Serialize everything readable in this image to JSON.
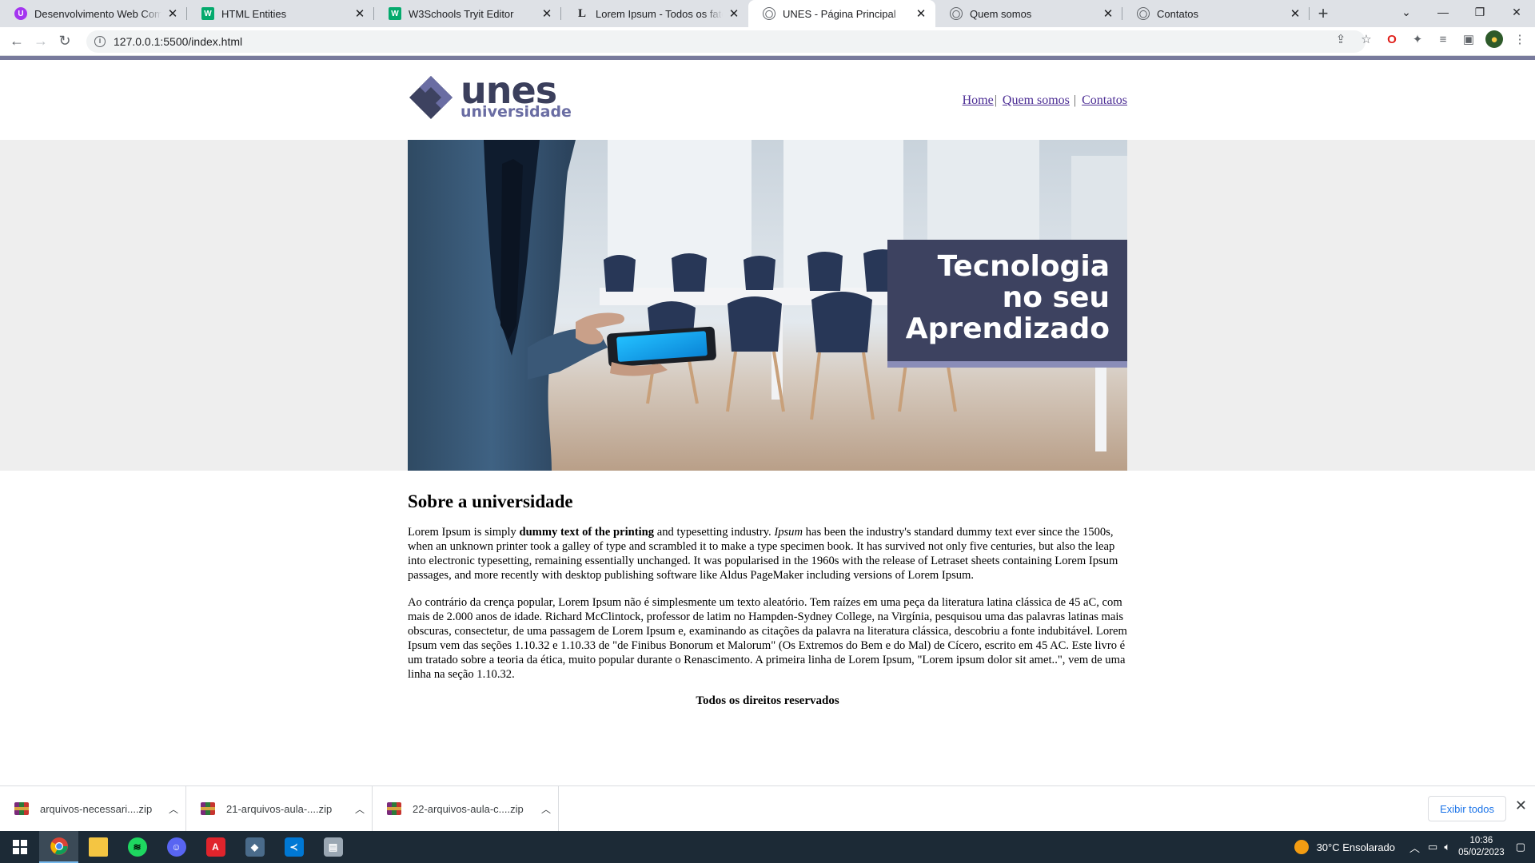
{
  "browser": {
    "tabs": [
      {
        "title": "Desenvolvimento Web Completo",
        "favicon_color": "#a435f0",
        "favicon_glyph": "U"
      },
      {
        "title": "HTML Entities",
        "favicon_color": "#04aa6d",
        "favicon_glyph": "W"
      },
      {
        "title": "W3Schools Tryit Editor",
        "favicon_color": "#04aa6d",
        "favicon_glyph": "W"
      },
      {
        "title": "Lorem Ipsum - Todos os fatos - Lipsum",
        "favicon_color": "#ffffff",
        "favicon_glyph": "L"
      },
      {
        "title": "UNES - Página Principal",
        "favicon_color": "#5f6368",
        "favicon_glyph": "globe"
      },
      {
        "title": "Quem somos",
        "favicon_color": "#5f6368",
        "favicon_glyph": "globe"
      },
      {
        "title": "Contatos",
        "favicon_color": "#5f6368",
        "favicon_glyph": "globe"
      }
    ],
    "active_tab_index": 4,
    "url": "127.0.0.1:5500/index.html"
  },
  "site": {
    "logo_main": "unes",
    "logo_sub": "universidade",
    "menu": {
      "home": "Home",
      "about": "Quem somos",
      "contact": "Contatos",
      "separator": "|"
    },
    "banner_lines": [
      "Tecnologia",
      "no seu",
      "Aprendizado"
    ],
    "section_title": "Sobre a universidade",
    "p1": {
      "a": "Lorem Ipsum is simply ",
      "bold": "dummy text of the printing",
      "b": " and typesetting industry. ",
      "italic": "Ipsum",
      "c": " has been the industry's standard dummy text ever since the 1500s, when an unknown printer took a galley of type and scrambled it to make a type specimen book. It has survived not only five centuries, but also the leap into electronic typesetting, remaining essentially unchanged. It was popularised in the 1960s with the release of Letraset sheets containing Lorem Ipsum passages, and more recently with desktop publishing software like Aldus PageMaker including versions of Lorem Ipsum."
    },
    "p2": "Ao contrário da crença popular, Lorem Ipsum não é simplesmente um texto aleatório. Tem raízes em uma peça da literatura latina clássica de 45 aC, com mais de 2.000 anos de idade. Richard McClintock, professor de latim no Hampden-Sydney College, na Virgínia, pesquisou uma das palavras latinas mais obscuras, consectetur, de uma passagem de Lorem Ipsum e, examinando as citações da palavra na literatura clássica, descobriu a fonte indubitável. Lorem Ipsum vem das seções 1.10.32 e 1.10.33 de \"de Finibus Bonorum et Malorum\" (Os Extremos do Bem e do Mal) de Cícero, escrito em 45 AC. Este livro é um tratado sobre a teoria da ética, muito popular durante o Renascimento. A primeira linha de Lorem Ipsum, \"Lorem ipsum dolor sit amet..\", vem de uma linha na seção 1.10.32.",
    "footer": "Todos os direitos reservados"
  },
  "downloads": {
    "items": [
      "arquivos-necessari....zip",
      "21-arquivos-aula-....zip",
      "22-arquivos-aula-c....zip"
    ],
    "show_all": "Exibir todos"
  },
  "taskbar": {
    "apps": [
      "start-icon",
      "chrome-icon",
      "file-explorer-icon",
      "spotify-icon",
      "discord-icon",
      "adobe-icon",
      "app-icon",
      "vscode-icon",
      "app-icon"
    ],
    "weather": "30°C  Ensolarado",
    "time": "10:36",
    "date": "05/02/2023"
  },
  "colors": {
    "brand_dark": "#3d4260",
    "brand_light": "#6a6da3",
    "topbar": "#787a9c"
  }
}
